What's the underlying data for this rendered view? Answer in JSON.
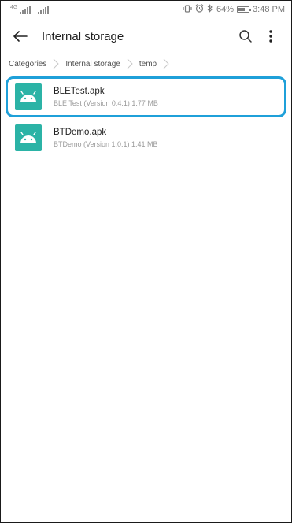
{
  "status_bar": {
    "signal_tag": "4G",
    "icons": [
      "vibrate-icon",
      "alarm-icon",
      "bluetooth-icon"
    ],
    "battery_percent": "64%",
    "time": "3:48 PM"
  },
  "app_bar": {
    "title": "Internal storage",
    "back_icon": "back-arrow-icon",
    "search_icon": "search-icon",
    "more_icon": "more-vert-icon"
  },
  "breadcrumb": {
    "items": [
      "Categories",
      "Internal storage",
      "temp"
    ]
  },
  "files": [
    {
      "name": "BLETest.apk",
      "meta": "BLE Test (Version 0.4.1) 1.77 MB",
      "selected": true,
      "icon": "android-apk-icon"
    },
    {
      "name": "BTDemo.apk",
      "meta": "BTDemo (Version 1.0.1) 1.41 MB",
      "selected": false,
      "icon": "android-apk-icon"
    }
  ],
  "colors": {
    "accent_outline": "#1fa0d9",
    "apk_icon_bg": "#2bb3a6"
  }
}
